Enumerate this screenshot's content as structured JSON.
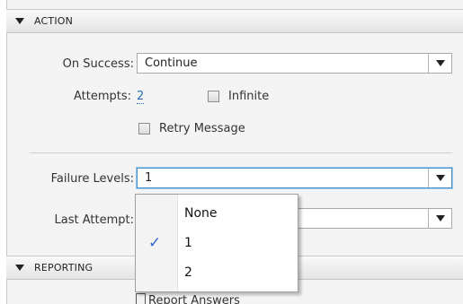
{
  "action": {
    "header": "ACTION",
    "on_success": {
      "label": "On Success:",
      "value": "Continue"
    },
    "attempts": {
      "label": "Attempts:",
      "value": "2"
    },
    "infinite": {
      "label": "Infinite",
      "checked": false
    },
    "retry_message": {
      "label": "Retry Message",
      "checked": false
    },
    "failure_levels": {
      "label": "Failure Levels:",
      "value": "1"
    },
    "last_attempt": {
      "label": "Last Attempt:",
      "value": ""
    }
  },
  "menu": {
    "options": [
      {
        "label": "None",
        "selected": false
      },
      {
        "label": "1",
        "selected": true
      },
      {
        "label": "2",
        "selected": false
      }
    ],
    "check_glyph": "✓"
  },
  "reporting": {
    "header": "REPORTING",
    "report_answers": {
      "label": "Report Answers",
      "checked": true
    }
  },
  "colors": {
    "focus_border": "#4a90c8",
    "link": "#2a6db5",
    "check": "#3366cc"
  },
  "icons": [
    "expand-triangle-icon",
    "dropdown-caret-icon",
    "checkmark-icon"
  ]
}
